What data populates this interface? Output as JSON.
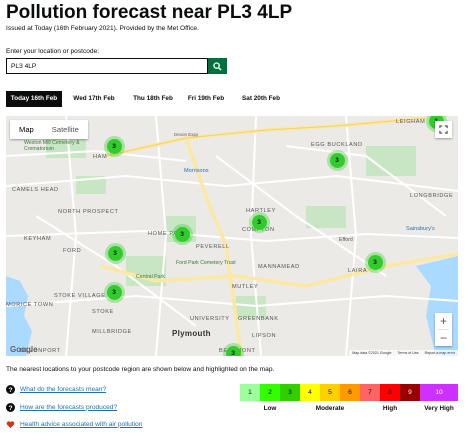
{
  "page": {
    "title": "Pollution forecast near PL3 4LP",
    "issued": "Issued at Today (16th February 2021). Provided by the Met Office."
  },
  "search": {
    "label": "Enter your location or postcode:",
    "value": "PL3 4LP",
    "button_icon": "search-icon"
  },
  "tabs": [
    {
      "label": "Today 16th Feb",
      "active": true
    },
    {
      "label": "Wed 17th Feb",
      "active": false
    },
    {
      "label": "Thu 18th Feb",
      "active": false
    },
    {
      "label": "Fri 19th Feb",
      "active": false
    },
    {
      "label": "Sat 20th Feb",
      "active": false
    }
  ],
  "map": {
    "type_buttons": [
      "Map",
      "Satellite"
    ],
    "selected_type": "Map",
    "zoom_in": "+",
    "zoom_out": "−",
    "google_logo": "Google",
    "footer": [
      "Map data ©2021 Google",
      "Terms of Use",
      "Report a map error"
    ],
    "markers": [
      {
        "value": "3",
        "band_color": "#31cc2c"
      },
      {
        "value": "3",
        "band_color": "#31cc2c"
      },
      {
        "value": "3",
        "band_color": "#31cc2c"
      },
      {
        "value": "3",
        "band_color": "#31cc2c"
      },
      {
        "value": "3",
        "band_color": "#31cc2c"
      },
      {
        "value": "3",
        "band_color": "#31cc2c"
      },
      {
        "value": "3",
        "band_color": "#31cc2c"
      },
      {
        "value": "3",
        "band_color": "#31cc2c"
      },
      {
        "value": "3",
        "band_color": "#31cc2c"
      }
    ],
    "place_labels": {
      "ham": "HAM",
      "camels_head": "CAMELS HEAD",
      "north_prospect": "NORTH PROSPECT",
      "keyham": "KEYHAM",
      "ford": "FORD",
      "home_park": "HOME PARK",
      "peverell": "PEVERELL",
      "hartley": "HARTLEY",
      "compton": "COMPTON",
      "egg_buckland": "EGG BUCKLAND",
      "mannamead": "MANNAMEAD",
      "mutley": "MUTLEY",
      "laira": "LAIRA",
      "efford": "Efford",
      "stoke_village": "STOKE VILLAGE",
      "stoke": "STOKE",
      "morice_town": "MORICE TOWN",
      "millbridge": "MILLBRIDGE",
      "university": "UNIVERSITY",
      "greenbank": "GREENBANK",
      "lipson": "LIPSON",
      "plymouth": "Plymouth",
      "beaumont": "BEAUMONT",
      "leigham": "LEIGHAM",
      "longbridge": "LONGBRIDGE",
      "devonport": "DEVONPORT",
      "cemetery": "Ford Park Cemetery Trust",
      "central_park": "Central Park",
      "morrisons": "Morrisons",
      "sainsburys": "Sainsbury's",
      "mill_cemetery": "Weston Mill Cemetery & Crematorium",
      "devon_expy": "Devon Expy"
    }
  },
  "nearest_text": "The nearest locations to your postcode region are shown below and highlighted on the map.",
  "links": [
    {
      "icon": "question-circle-icon",
      "label": "What do the forecasts mean?"
    },
    {
      "icon": "question-circle-icon",
      "label": "How are the forecasts produced?"
    },
    {
      "icon": "heart-icon",
      "label": "Health advice associated with air pollution"
    }
  ],
  "bands": {
    "levels": [
      {
        "value": "1",
        "color": "#9cff9c"
      },
      {
        "value": "2",
        "color": "#31ff00"
      },
      {
        "value": "3",
        "color": "#31cf00"
      },
      {
        "value": "4",
        "color": "#ffff00"
      },
      {
        "value": "5",
        "color": "#ffcf00"
      },
      {
        "value": "6",
        "color": "#ff9a00"
      },
      {
        "value": "7",
        "color": "#ff6464"
      },
      {
        "value": "8",
        "color": "#ff0000"
      },
      {
        "value": "9",
        "color": "#990000"
      },
      {
        "value": "10",
        "color": "#ce30ff"
      }
    ],
    "labels": [
      "Low",
      "Moderate",
      "High",
      "Very High"
    ]
  },
  "colors": {
    "accent_green": "#00703c",
    "link_blue": "#1d70b8",
    "text": "#0b0c0c"
  }
}
